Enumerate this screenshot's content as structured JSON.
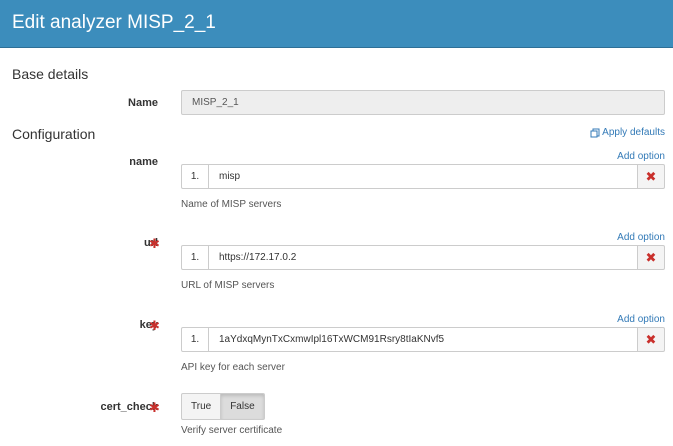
{
  "header": {
    "title": "Edit analyzer MISP_2_1"
  },
  "base_details": {
    "section_title": "Base details",
    "name_label": "Name",
    "name_value": "MISP_2_1"
  },
  "configuration": {
    "section_title": "Configuration",
    "apply_defaults": "Apply defaults",
    "fields": [
      {
        "label": "name",
        "required": false,
        "add_option": "Add option",
        "index": "1.",
        "value": "misp",
        "help": "Name of MISP servers"
      },
      {
        "label": "url",
        "required": true,
        "add_option": "Add option",
        "index": "1.",
        "value": "https://172.17.0.2",
        "help": "URL of MISP servers"
      },
      {
        "label": "key",
        "required": true,
        "add_option": "Add option",
        "index": "1.",
        "value": "1aYdxqMynTxCxmwIpl16TxWCM91Rsry8tIaKNvf5",
        "help": "API key for each server"
      }
    ],
    "cert_check": {
      "label": "cert_check",
      "required": true,
      "options": [
        "True",
        "False"
      ],
      "selected": "False",
      "help": "Verify server certificate"
    }
  },
  "icons": {
    "required": "asterisk-icon",
    "delete": "times-icon",
    "apply": "copy-icon"
  },
  "colors": {
    "header_bg": "#3c8dbc",
    "link": "#337ab7",
    "danger": "#c9302c"
  }
}
